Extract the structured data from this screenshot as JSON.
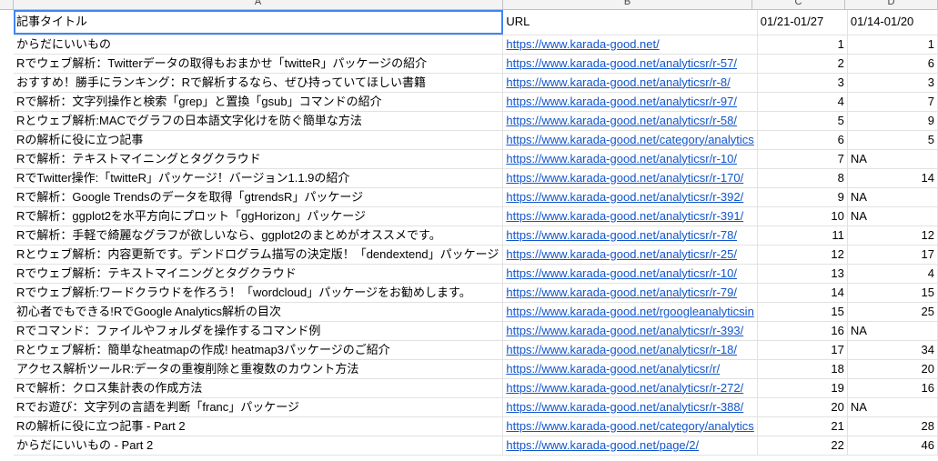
{
  "columns": [
    "A",
    "B",
    "C",
    "D"
  ],
  "header": {
    "a": "記事タイトル",
    "b": "URL",
    "c": "01/21-01/27",
    "d": "01/14-01/20"
  },
  "rows": [
    {
      "title": "からだにいいもの",
      "url": "https://www.karada-good.net/",
      "c": "1",
      "d": "1"
    },
    {
      "title": "Rでウェブ解析：Twitterデータの取得もおまかせ「twitteR」パッケージの紹介",
      "url": "https://www.karada-good.net/analyticsr/r-57/",
      "c": "2",
      "d": "6"
    },
    {
      "title": "おすすめ！勝手にランキング：Rで解析するなら、ぜひ持っていてほしい書籍",
      "url": "https://www.karada-good.net/analyticsr/r-8/",
      "c": "3",
      "d": "3"
    },
    {
      "title": "Rで解析：文字列操作と検索「grep」と置換「gsub」コマンドの紹介",
      "url": "https://www.karada-good.net/analyticsr/r-97/",
      "c": "4",
      "d": "7"
    },
    {
      "title": "Rとウェブ解析:MACでグラフの日本語文字化けを防ぐ簡単な方法",
      "url": "https://www.karada-good.net/analyticsr/r-58/",
      "c": "5",
      "d": "9"
    },
    {
      "title": "Rの解析に役に立つ記事",
      "url": "https://www.karada-good.net/category/analytics",
      "c": "6",
      "d": "5"
    },
    {
      "title": "Rで解析：テキストマイニングとタグクラウド",
      "url": "https://www.karada-good.net/analyticsr/r-10/",
      "c": "7",
      "d": "NA"
    },
    {
      "title": "RでTwitter操作:「twitteR」パッケージ！バージョン1.1.9の紹介",
      "url": "https://www.karada-good.net/analyticsr/r-170/",
      "c": "8",
      "d": "14"
    },
    {
      "title": "Rで解析：Google Trendsのデータを取得「gtrendsR」パッケージ",
      "url": "https://www.karada-good.net/analyticsr/r-392/",
      "c": "9",
      "d": "NA"
    },
    {
      "title": "Rで解析：ggplot2を水平方向にプロット「ggHorizon」パッケージ",
      "url": "https://www.karada-good.net/analyticsr/r-391/",
      "c": "10",
      "d": "NA"
    },
    {
      "title": "Rで解析：手軽で綺麗なグラフが欲しいなら、ggplot2のまとめがオススメです。",
      "url": "https://www.karada-good.net/analyticsr/r-78/",
      "c": "11",
      "d": "12"
    },
    {
      "title": "Rとウェブ解析：内容更新です。デンドログラム描写の決定版！「dendextend」パッケージ",
      "url": "https://www.karada-good.net/analyticsr/r-25/",
      "c": "12",
      "d": "17"
    },
    {
      "title": "Rでウェブ解析：テキストマイニングとタグクラウド",
      "url": "https://www.karada-good.net/analyticsr/r-10/",
      "c": "13",
      "d": "4"
    },
    {
      "title": "Rでウェブ解析:ワードクラウドを作ろう！「wordcloud」パッケージをお勧めします。",
      "url": "https://www.karada-good.net/analyticsr/r-79/",
      "c": "14",
      "d": "15"
    },
    {
      "title": "初心者でもできる!RでGoogle Analytics解析の目次",
      "url": "https://www.karada-good.net/rgoogleanalyticsin",
      "c": "15",
      "d": "25"
    },
    {
      "title": "Rでコマンド：ファイルやフォルダを操作するコマンド例",
      "url": "https://www.karada-good.net/analyticsr/r-393/",
      "c": "16",
      "d": "NA"
    },
    {
      "title": "Rとウェブ解析：簡単なheatmapの作成! heatmap3パッケージのご紹介",
      "url": "https://www.karada-good.net/analyticsr/r-18/",
      "c": "17",
      "d": "34"
    },
    {
      "title": "アクセス解析ツールR:データの重複削除と重複数のカウント方法",
      "url": "https://www.karada-good.net/analyticsr/r/",
      "c": "18",
      "d": "20"
    },
    {
      "title": "Rで解析：クロス集計表の作成方法",
      "url": "https://www.karada-good.net/analyticsr/r-272/",
      "c": "19",
      "d": "16"
    },
    {
      "title": "Rでお遊び：文字列の言語を判断「franc」パッケージ",
      "url": "https://www.karada-good.net/analyticsr/r-388/",
      "c": "20",
      "d": "NA"
    },
    {
      "title": "Rの解析に役に立つ記事 - Part 2",
      "url": "https://www.karada-good.net/category/analytics",
      "c": "21",
      "d": "28"
    },
    {
      "title": "からだにいいもの - Part 2",
      "url": "https://www.karada-good.net/page/2/",
      "c": "22",
      "d": "46"
    }
  ]
}
